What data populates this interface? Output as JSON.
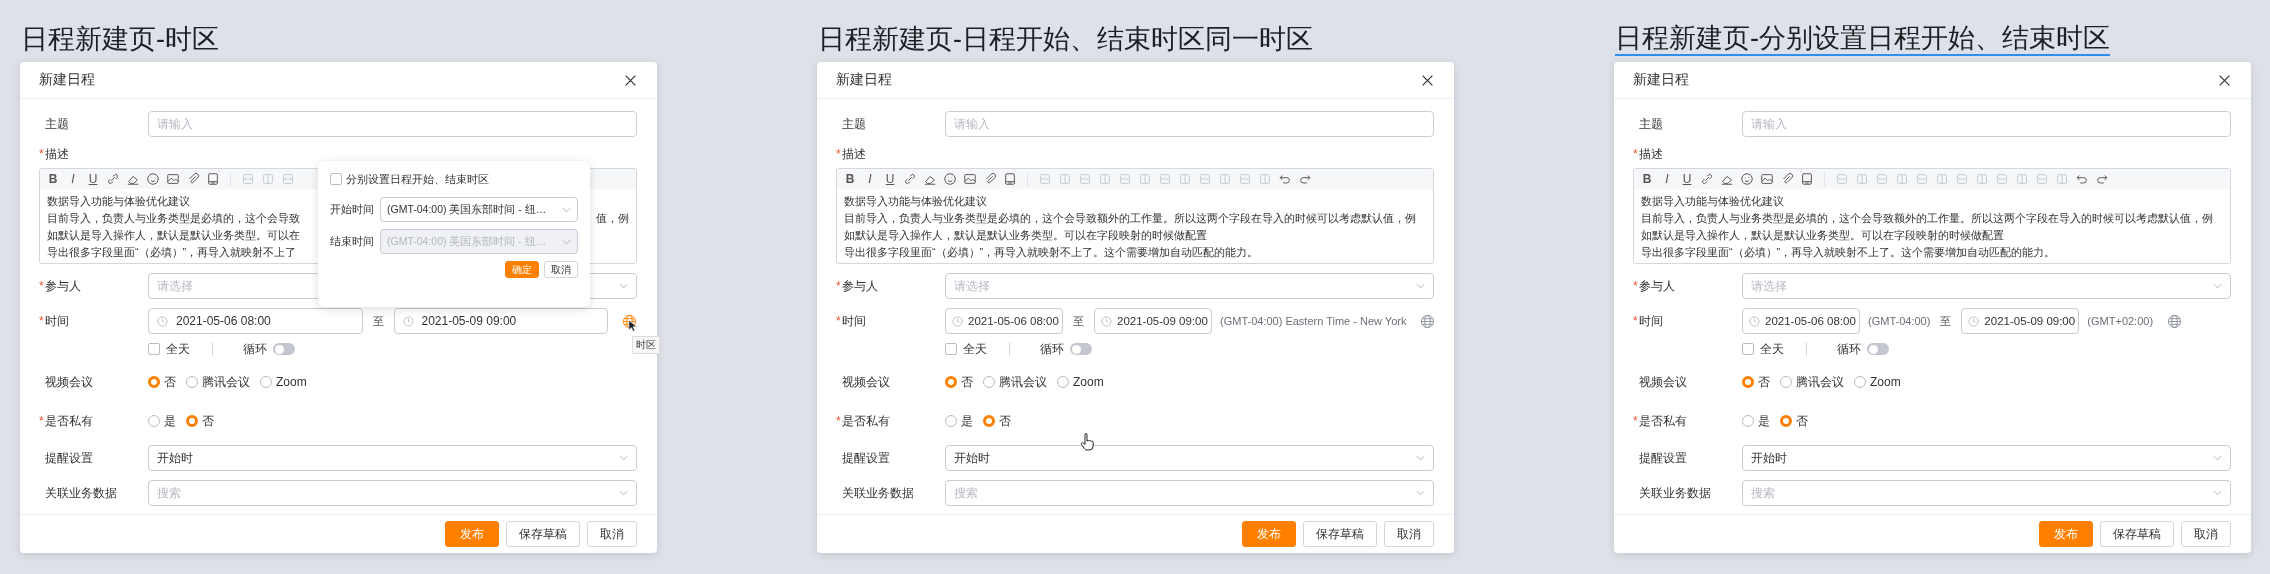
{
  "panels": [
    {
      "heading": "日程新建页-时区",
      "heading_underlined": false,
      "dialog": {
        "title": "新建日程",
        "fields": [
          {
            "kind": "input",
            "label": "主题",
            "placeholder": "请输入"
          },
          {
            "kind": "editor",
            "label": "描述",
            "required_mark": "*",
            "format_buttons": [
              "B",
              "I",
              "U"
            ],
            "lines": [
              {
                "text": "数据导入功能与体验优化建议"
              },
              {
                "text": "目前导入，负责人与业务类型是必填的，这个会导致",
                "tail": "值，例"
              },
              {
                "text": "如默认是导入操作人，默认是默认业务类型。可以在"
              },
              {
                "text": "导出很多字段里面“（必填）”，再导入就映射不上了"
              }
            ]
          },
          {
            "kind": "select",
            "label": "参与人",
            "required_mark": "*",
            "placeholder": "请选择"
          },
          {
            "kind": "time",
            "label": "时间",
            "required_mark": "*",
            "start": "2021-05-06 08:00",
            "separator": "至",
            "end": "2021-05-09 09:00",
            "zone_active": true,
            "tooltip": "时区",
            "arrow_cursor": true,
            "all_day": {
              "label": "全天",
              "checked": false
            },
            "repeat": {
              "label": "循环",
              "on": false
            }
          },
          {
            "kind": "radio",
            "label": "视频会议",
            "options": [
              {
                "label": "否",
                "selected": true
              },
              {
                "label": "腾讯会议",
                "selected": false
              },
              {
                "label": "Zoom",
                "selected": false
              }
            ]
          },
          {
            "kind": "radio",
            "label": "是否私有",
            "required_mark": "*",
            "options": [
              {
                "label": "是",
                "selected": false
              },
              {
                "label": "否",
                "selected": true
              }
            ]
          },
          {
            "kind": "select",
            "label": "提醒设置",
            "value": "开始时"
          },
          {
            "kind": "select",
            "label": "关联业务数据",
            "placeholder": "搜索"
          }
        ],
        "buttons": [
          {
            "label": "发布",
            "primary": true
          },
          {
            "label": "保存草稿",
            "primary": false
          },
          {
            "label": "取消",
            "primary": false
          }
        ]
      },
      "popover": {
        "checkbox": {
          "label": "分别设置日程开始、结束时区",
          "checked": false
        },
        "rows": [
          {
            "label": "开始时间",
            "value": "(GMT-04:00) 美国东部时间 - 纽…",
            "disabled": false
          },
          {
            "label": "结束时间",
            "value": "(GMT-04:00) 美国东部时间 - 纽…",
            "disabled": true
          }
        ],
        "buttons": [
          {
            "label": "确定",
            "primary": true
          },
          {
            "label": "取消",
            "primary": false
          }
        ]
      }
    },
    {
      "heading": "日程新建页-日程开始、结束时区同一时区",
      "heading_underlined": false,
      "dialog": {
        "title": "新建日程",
        "fields": [
          {
            "kind": "input",
            "label": "主题",
            "placeholder": "请输入"
          },
          {
            "kind": "editor",
            "label": "描述",
            "required_mark": "*",
            "format_buttons": [
              "B",
              "I",
              "U"
            ],
            "lines": [
              {
                "text": "数据导入功能与体验优化建议"
              },
              {
                "text": "目前导入，负责人与业务类型是必填的，这个会导致额外的工作量。所以这两个字段在导入的时候可以考虑默认值，例"
              },
              {
                "text": "如默认是导入操作人，默认是默认业务类型。可以在字段映射的时候做配置"
              },
              {
                "text": "导出很多字段里面“（必填）”，再导入就映射不上了。这个需要增加自动匹配的能力。"
              }
            ]
          },
          {
            "kind": "select",
            "label": "参与人",
            "required_mark": "*",
            "placeholder": "请选择"
          },
          {
            "kind": "time",
            "label": "时间",
            "required_mark": "*",
            "start": "2021-05-06 08:00",
            "separator": "至",
            "end": "2021-05-09 09:00",
            "zone": "(GMT-04:00) Eastern Time - New York",
            "zone_active": false,
            "all_day": {
              "label": "全天",
              "checked": false
            },
            "repeat": {
              "label": "循环",
              "on": false
            }
          },
          {
            "kind": "radio",
            "label": "视频会议",
            "options": [
              {
                "label": "否",
                "selected": true
              },
              {
                "label": "腾讯会议",
                "selected": false
              },
              {
                "label": "Zoom",
                "selected": false
              }
            ]
          },
          {
            "kind": "radio",
            "label": "是否私有",
            "required_mark": "*",
            "options": [
              {
                "label": "是",
                "selected": false
              },
              {
                "label": "否",
                "selected": true
              }
            ]
          },
          {
            "kind": "select",
            "label": "提醒设置",
            "value": "开始时",
            "hand_cursor": true
          },
          {
            "kind": "select",
            "label": "关联业务数据",
            "placeholder": "搜索"
          }
        ],
        "buttons": [
          {
            "label": "发布",
            "primary": true
          },
          {
            "label": "保存草稿",
            "primary": false
          },
          {
            "label": "取消",
            "primary": false
          }
        ]
      }
    },
    {
      "heading": "日程新建页-分别设置日程开始、结束时区",
      "heading_underlined": true,
      "dialog": {
        "title": "新建日程",
        "fields": [
          {
            "kind": "input",
            "label": "主题",
            "placeholder": "请输入"
          },
          {
            "kind": "editor",
            "label": "描述",
            "required_mark": "*",
            "format_buttons": [
              "B",
              "I",
              "U"
            ],
            "lines": [
              {
                "text": "数据导入功能与体验优化建议"
              },
              {
                "text": "目前导入，负责人与业务类型是必填的，这个会导致额外的工作量。所以这两个字段在导入的时候可以考虑默认值，例"
              },
              {
                "text": "如默认是导入操作人，默认是默认业务类型。可以在字段映射的时候做配置"
              },
              {
                "text": "导出很多字段里面“（必填）”，再导入就映射不上了。这个需要增加自动匹配的能力。"
              }
            ]
          },
          {
            "kind": "select",
            "label": "参与人",
            "required_mark": "*",
            "placeholder": "请选择"
          },
          {
            "kind": "time",
            "label": "时间",
            "required_mark": "*",
            "start": "2021-05-06 08:00",
            "start_zone": "(GMT-04:00)",
            "separator": "至",
            "end": "2021-05-09 09:00",
            "end_zone": "(GMT+02:00)",
            "zone_active": false,
            "all_day": {
              "label": "全天",
              "checked": false
            },
            "repeat": {
              "label": "循环",
              "on": false
            }
          },
          {
            "kind": "radio",
            "label": "视频会议",
            "options": [
              {
                "label": "否",
                "selected": true
              },
              {
                "label": "腾讯会议",
                "selected": false
              },
              {
                "label": "Zoom",
                "selected": false
              }
            ]
          },
          {
            "kind": "radio",
            "label": "是否私有",
            "required_mark": "*",
            "options": [
              {
                "label": "是",
                "selected": false
              },
              {
                "label": "否",
                "selected": true
              }
            ]
          },
          {
            "kind": "select",
            "label": "提醒设置",
            "value": "开始时"
          },
          {
            "kind": "select",
            "label": "关联业务数据",
            "placeholder": "搜索"
          }
        ],
        "buttons": [
          {
            "label": "发布",
            "primary": true
          },
          {
            "label": "保存草稿",
            "primary": false
          },
          {
            "label": "取消",
            "primary": false
          }
        ]
      }
    }
  ]
}
